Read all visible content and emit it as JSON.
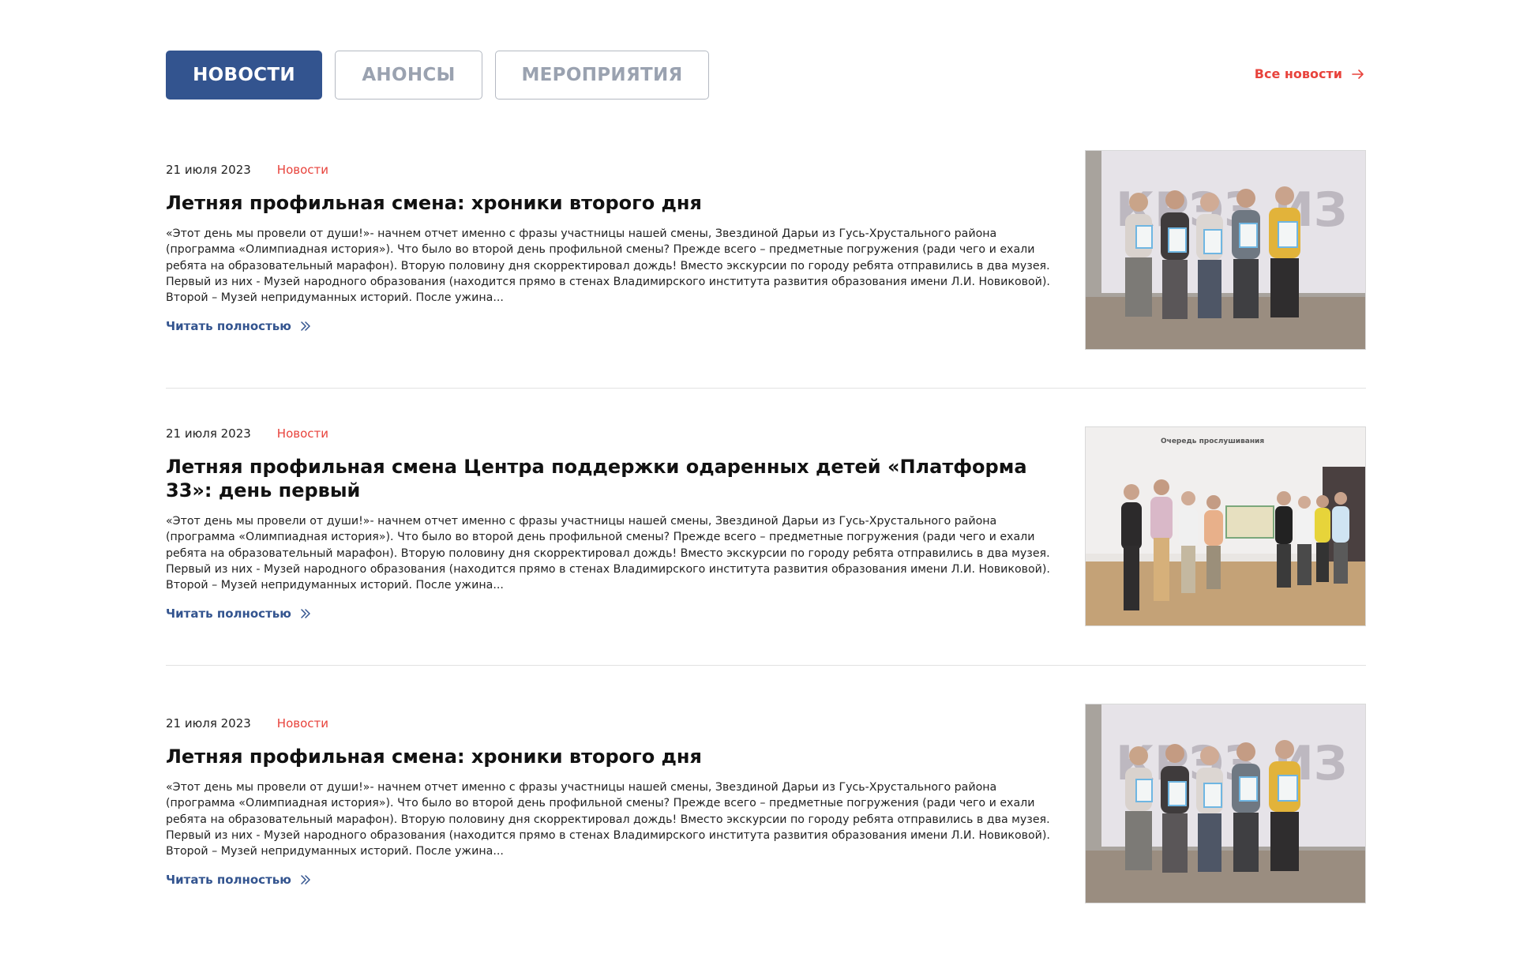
{
  "tabs": {
    "news": "НОВОСТИ",
    "announcements": "АНОНСЫ",
    "events": "МЕРОПРИЯТИЯ"
  },
  "all_news_label": "Все новости",
  "colors": {
    "primary": "#33548f",
    "accent": "#e8433c",
    "inactive_text": "#9aa2b0",
    "inactive_border": "#b4b9c2"
  },
  "news": [
    {
      "date": "21 июля 2023",
      "category": "Новости",
      "title": "Летняя профильная смена: хроники второго дня",
      "excerpt": "«Этот день мы провели от души!»- начнем отчет именно с фразы участницы нашей смены, Звездиной Дарьи из Гусь-Хрустального района (программа «Олимпиадная история»). Что было во второй день профильной смены? Прежде всего – предметные погружения (ради чего и ехали ребята на образовательный марафон). Вторую половину дня скорректировал дождь! Вместо экскурсии по городу ребята отправились в два музея. Первый из них - Музей народного образования (находится прямо в стенах Владимирского института развития образования имени Л.И. Новиковой). Второй – Музей непридуманных историй. После ужина...",
      "read_more": "Читать полностью",
      "image_icon": "group-photo-certificates"
    },
    {
      "date": "21 июля 2023",
      "category": "Новости",
      "title": "Летняя профильная смена Центра поддержки одаренных детей «Платформа 33»: день первый",
      "excerpt": "«Этот день мы провели от души!»- начнем отчет именно с фразы участницы нашей смены, Звездиной Дарьи из Гусь-Хрустального района (программа «Олимпиадная история»). Что было во второй день профильной смены? Прежде всего – предметные погружения (ради чего и ехали ребята на образовательный марафон). Вторую половину дня скорректировал дождь! Вместо экскурсии по городу ребята отправились в два музея. Первый из них - Музей народного образования (находится прямо в стенах Владимирского института развития образования имени Л.И. Новиковой). Второй – Музей непридуманных историй. После ужина...",
      "read_more": "Читать полностью",
      "image_icon": "group-photo-stage",
      "image_caption": "Очередь прослушивания"
    },
    {
      "date": "21 июля 2023",
      "category": "Новости",
      "title": "Летняя профильная смена: хроники второго дня",
      "excerpt": "«Этот день мы провели от души!»- начнем отчет именно с фразы участницы нашей смены, Звездиной Дарьи из Гусь-Хрустального района (программа «Олимпиадная история»). Что было во второй день профильной смены? Прежде всего – предметные погружения (ради чего и ехали ребята на образовательный марафон). Вторую половину дня скорректировал дождь! Вместо экскурсии по городу ребята отправились в два музея. Первый из них - Музей народного образования (находится прямо в стенах Владимирского института развития образования имени Л.И. Новиковой). Второй – Музей непридуманных историй. После ужина...",
      "read_more": "Читать полностью",
      "image_icon": "group-photo-certificates"
    }
  ]
}
